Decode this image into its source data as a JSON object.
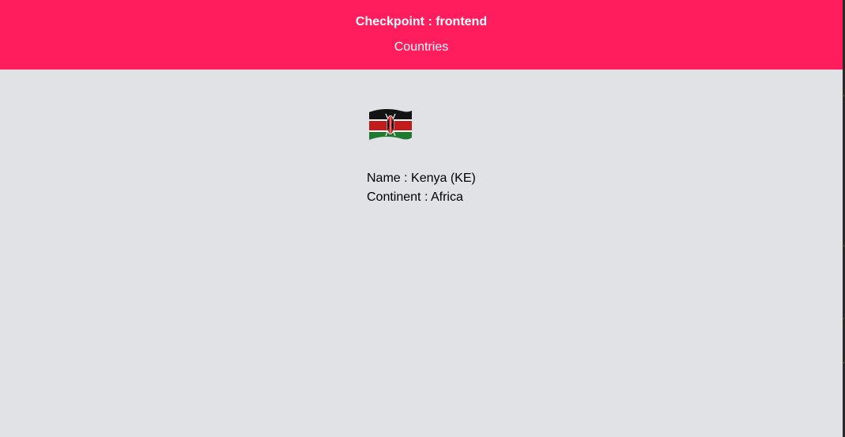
{
  "header": {
    "title": "Checkpoint : frontend",
    "nav_label": "Countries",
    "background": "#ff1d5e"
  },
  "country": {
    "flag_icon": "kenya-flag",
    "name_line": "Name : Kenya (KE)",
    "continent_line": "Continent : Africa"
  },
  "colors": {
    "page_background": "#e1e2e6",
    "text": "#000000"
  }
}
